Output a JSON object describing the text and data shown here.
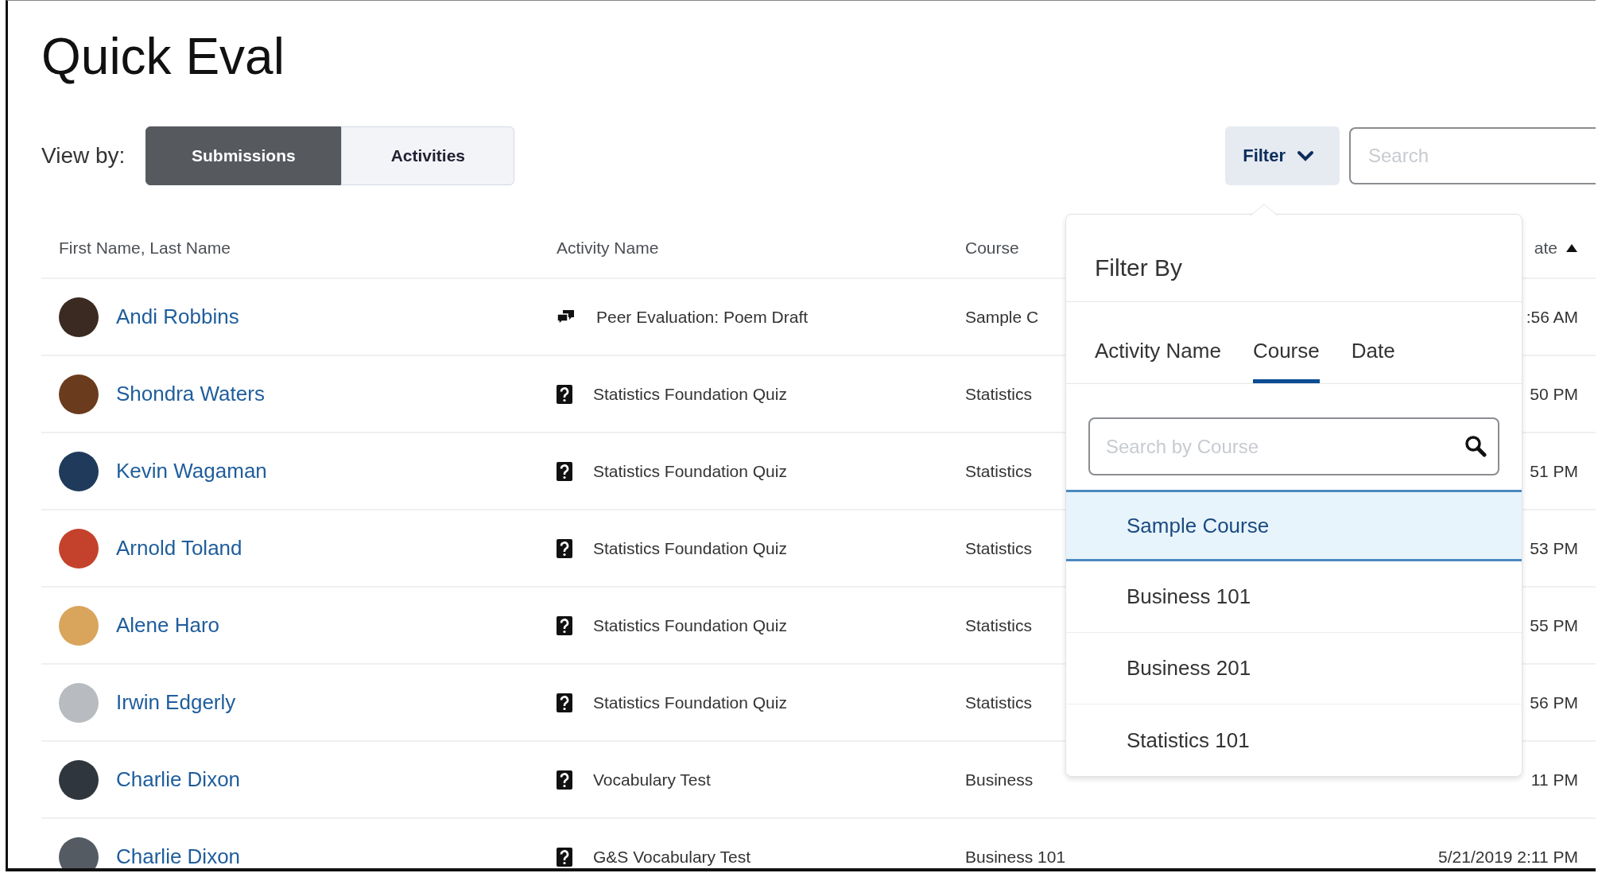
{
  "title": "Quick Eval",
  "view_by": {
    "label": "View by:",
    "options": [
      {
        "label": "Submissions",
        "selected": true
      },
      {
        "label": "Activities",
        "selected": false
      }
    ]
  },
  "filter_button": {
    "label": "Filter"
  },
  "search": {
    "placeholder": "Search"
  },
  "table": {
    "columns": [
      "First Name, Last Name",
      "Activity Name",
      "Course",
      "ate"
    ],
    "rows": [
      {
        "name": "Andi Robbins",
        "activity": {
          "kind": "discussion",
          "name": "Peer Evaluation: Poem Draft"
        },
        "course": "Sample C",
        "date": ":56 AM"
      },
      {
        "name": "Shondra Waters",
        "activity": {
          "kind": "quiz",
          "name": "Statistics Foundation Quiz"
        },
        "course": "Statistics",
        "date": "50 PM"
      },
      {
        "name": "Kevin Wagaman",
        "activity": {
          "kind": "quiz",
          "name": "Statistics Foundation Quiz"
        },
        "course": "Statistics",
        "date": "51 PM"
      },
      {
        "name": "Arnold Toland",
        "activity": {
          "kind": "quiz",
          "name": "Statistics Foundation Quiz"
        },
        "course": "Statistics",
        "date": "53 PM"
      },
      {
        "name": "Alene Haro",
        "activity": {
          "kind": "quiz",
          "name": "Statistics Foundation Quiz"
        },
        "course": "Statistics",
        "date": "55 PM"
      },
      {
        "name": "Irwin Edgerly",
        "activity": {
          "kind": "quiz",
          "name": "Statistics Foundation Quiz"
        },
        "course": "Statistics",
        "date": "56 PM"
      },
      {
        "name": "Charlie Dixon",
        "activity": {
          "kind": "quiz",
          "name": "Vocabulary Test"
        },
        "course": "Business",
        "date": "11 PM"
      },
      {
        "name": "Charlie Dixon",
        "activity": {
          "kind": "quiz",
          "name": "G&S Vocabulary Test"
        },
        "course": "Business 101",
        "date": "5/21/2019 2:11 PM"
      }
    ]
  },
  "filter_popover": {
    "title": "Filter By",
    "tabs": [
      {
        "label": "Activity Name",
        "selected": false
      },
      {
        "label": "Course",
        "selected": true
      },
      {
        "label": "Date",
        "selected": false
      }
    ],
    "search": {
      "placeholder": "Search by Course"
    },
    "options": [
      {
        "label": "Sample Course",
        "selected": true
      },
      {
        "label": "Business 101",
        "selected": false
      },
      {
        "label": "Business 201",
        "selected": false
      },
      {
        "label": "Statistics 101",
        "selected": false
      }
    ]
  }
}
